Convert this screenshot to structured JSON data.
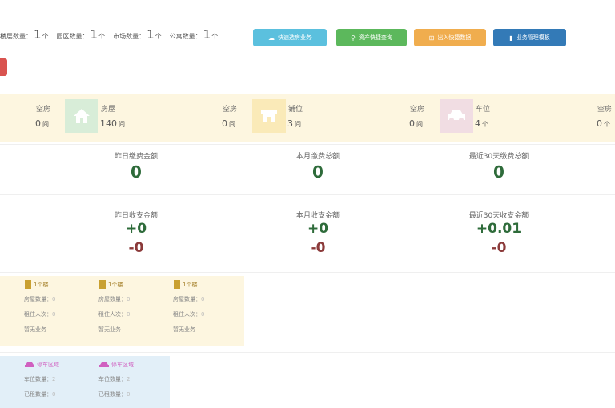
{
  "stats": [
    {
      "label": "楼层数量：",
      "value": "1",
      "unit": "个"
    },
    {
      "label": "园区数量：",
      "value": "1",
      "unit": "个"
    },
    {
      "label": "市场数量：",
      "value": "1",
      "unit": "个"
    },
    {
      "label": "公寓数量：",
      "value": "1",
      "unit": "个"
    }
  ],
  "buttons": [
    {
      "label": "快速选房业务",
      "icon": "☁",
      "color": "#5bc0de"
    },
    {
      "label": "资产快捷查询",
      "icon": "⚲",
      "color": "#5cb85c"
    },
    {
      "label": "出入快捷数据",
      "icon": "⊞",
      "color": "#f0ad4e"
    },
    {
      "label": "业务管理模板",
      "icon": "▮",
      "color": "#337ab7"
    }
  ],
  "overview": [
    {
      "title": "空房",
      "value": "0",
      "unit": "间"
    },
    {
      "title": "房屋",
      "value": "140",
      "unit": "间"
    },
    {
      "title": "空房",
      "value": "0",
      "unit": "间"
    },
    {
      "title": "铺位",
      "value": "3",
      "unit": "间"
    },
    {
      "title": "空房",
      "value": "0",
      "unit": "间"
    },
    {
      "title": "车位",
      "value": "4",
      "unit": "个"
    },
    {
      "title": "空房",
      "value": "0",
      "unit": "个"
    }
  ],
  "fees": [
    {
      "title": "昨日缴费金额",
      "value": "0"
    },
    {
      "title": "本月缴费总额",
      "value": "0"
    },
    {
      "title": "最近30天缴费总额",
      "value": "0"
    }
  ],
  "income": [
    {
      "title": "昨日收支金额",
      "plus": "+0",
      "minus": "-0"
    },
    {
      "title": "本月收支金额",
      "plus": "+0",
      "minus": "-0"
    },
    {
      "title": "最近30天收支金额",
      "plus": "+0.01",
      "minus": "-0"
    }
  ],
  "buildings": [
    {
      "title": "1个楼",
      "rows": [
        {
          "k": "房屋数量：",
          "v": "0"
        },
        {
          "k": "租住人次：",
          "v": "0"
        }
      ],
      "link": "暂无业务"
    },
    {
      "title": "1个楼",
      "rows": [
        {
          "k": "房屋数量：",
          "v": "0"
        },
        {
          "k": "租住人次：",
          "v": "0"
        }
      ],
      "link": "暂无业务"
    },
    {
      "title": "1个楼",
      "rows": [
        {
          "k": "房屋数量：",
          "v": "0"
        },
        {
          "k": "租住人次：",
          "v": "0"
        }
      ],
      "link": "暂无业务"
    }
  ],
  "parkings": [
    {
      "title": "停车区域",
      "rows": [
        {
          "k": "车位数量：",
          "v": "2"
        },
        {
          "k": "已租数量：",
          "v": "0"
        }
      ]
    },
    {
      "title": "停车区域",
      "rows": [
        {
          "k": "车位数量：",
          "v": "2"
        },
        {
          "k": "已租数量：",
          "v": "0"
        }
      ]
    }
  ]
}
